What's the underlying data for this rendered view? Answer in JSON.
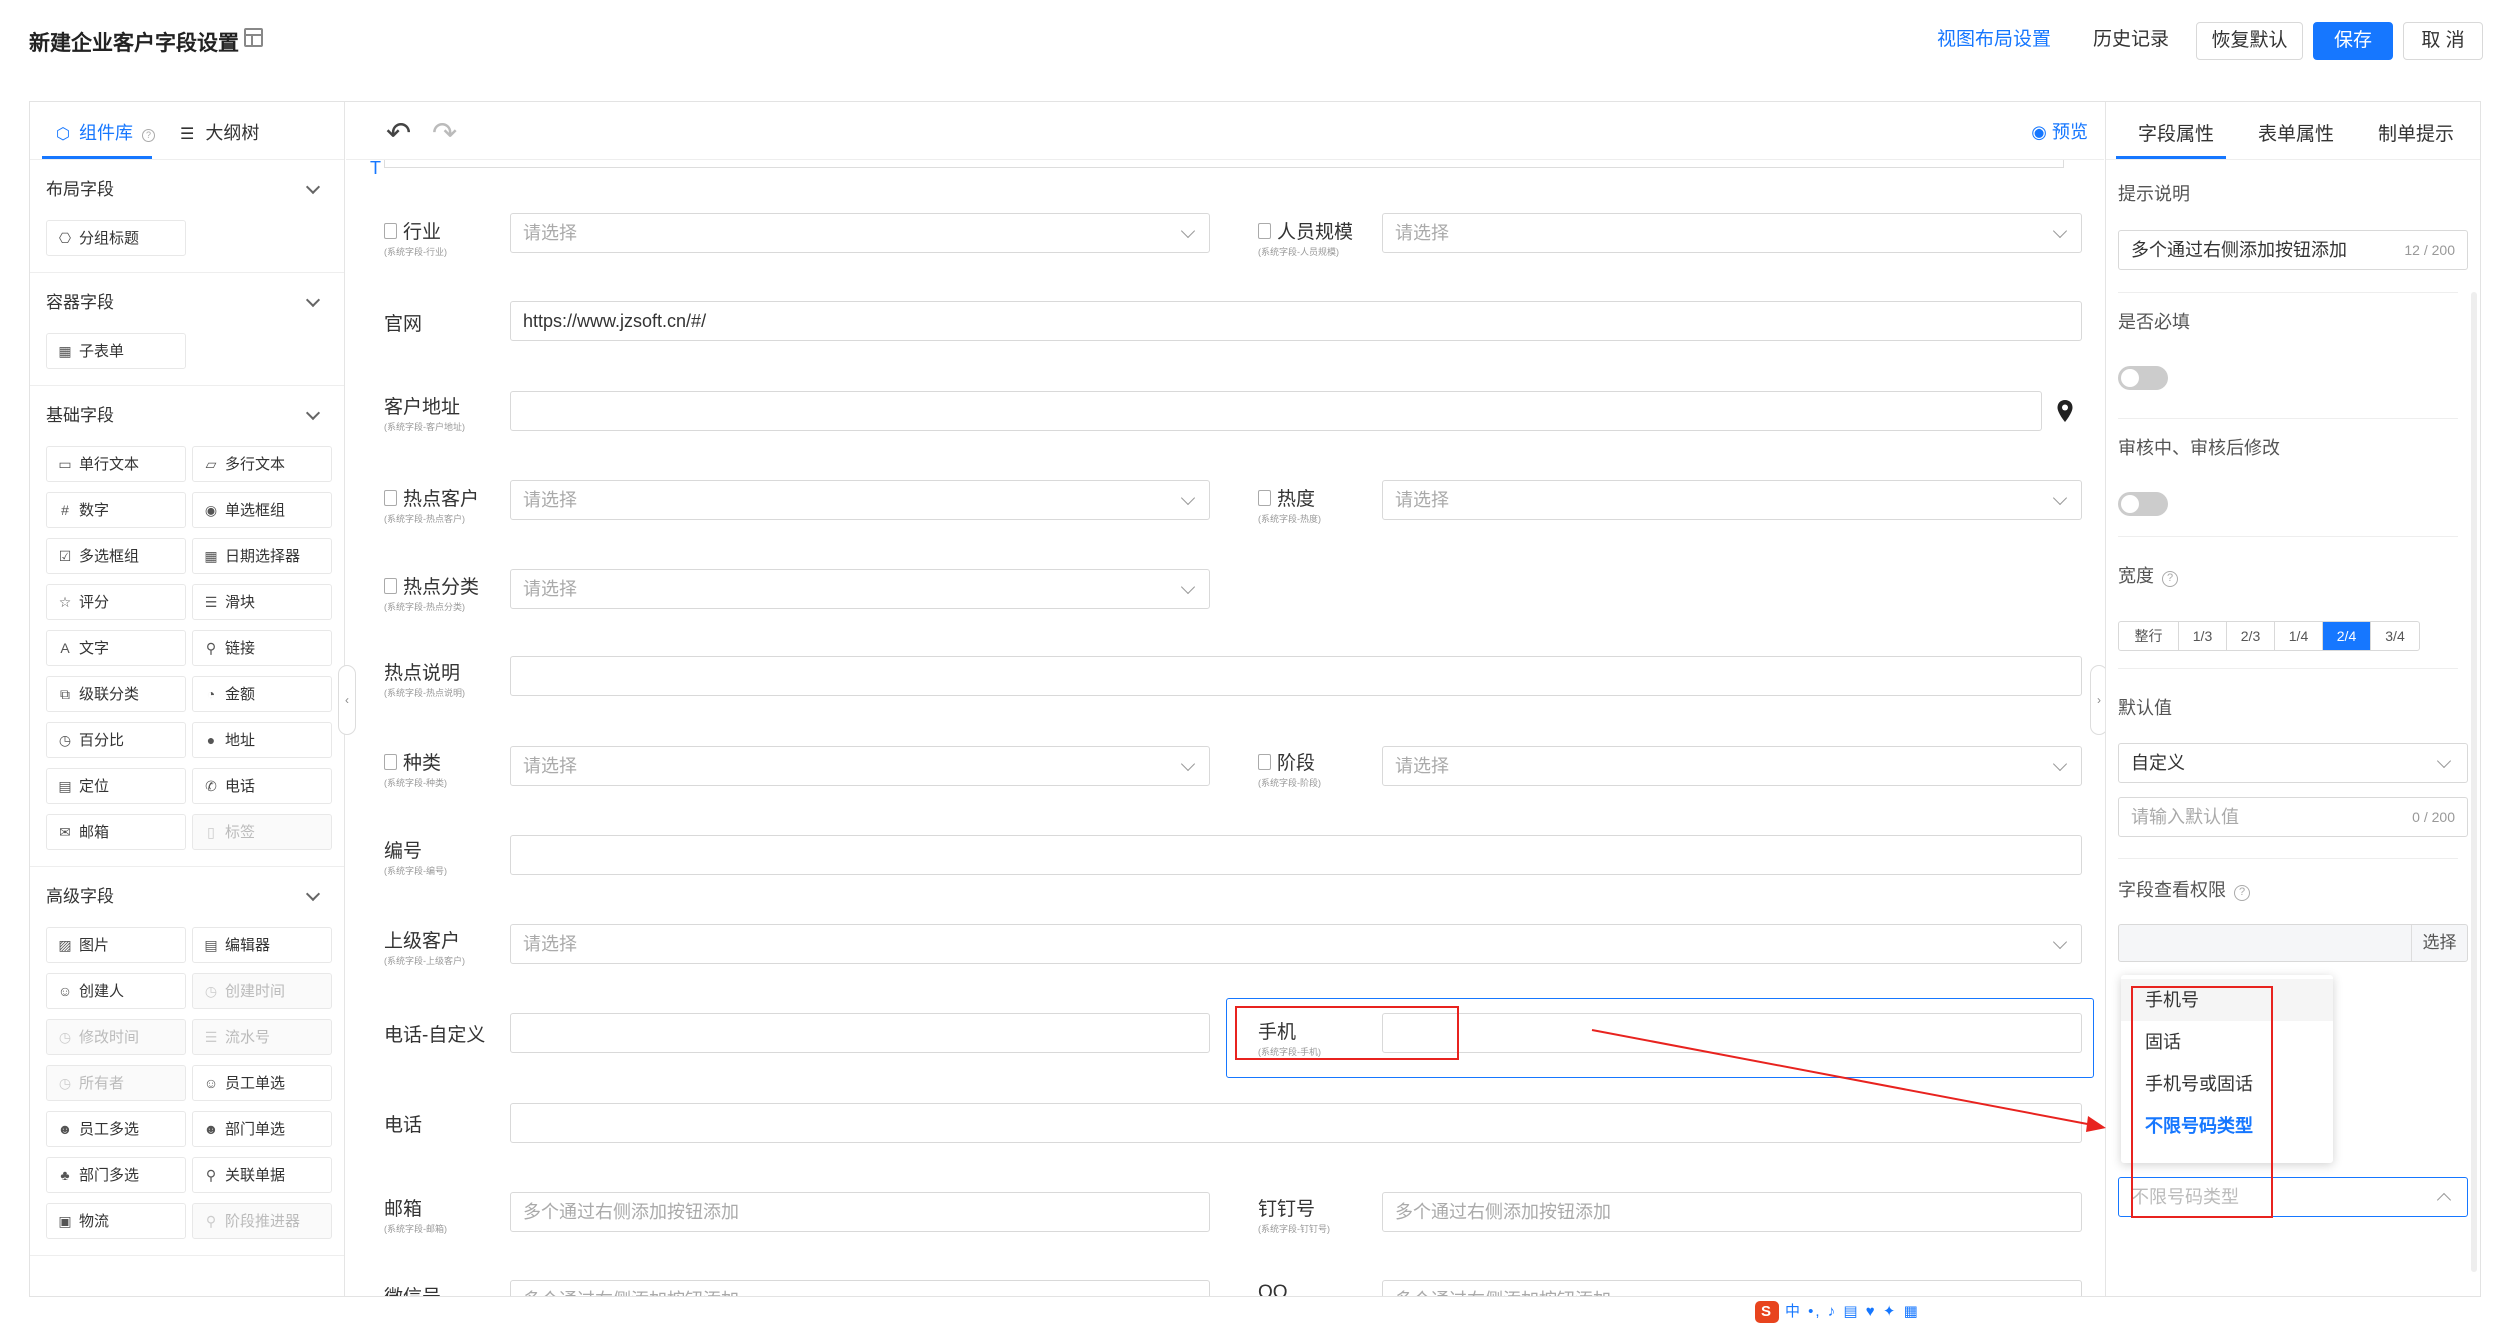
{
  "header": {
    "title": "新建企业客户字段设置",
    "layout_settings": "视图布局设置",
    "history": "历史记录",
    "restore_default": "恢复默认",
    "save": "保存",
    "cancel": "取 消"
  },
  "left_panel": {
    "tabs": [
      "组件库",
      "大纲树"
    ],
    "sections": [
      {
        "title": "布局字段",
        "items": [
          {
            "label": "分组标题",
            "icon": "group-title-icon",
            "glyph": "⎔",
            "disabled": false
          }
        ]
      },
      {
        "title": "容器字段",
        "items": [
          {
            "label": "子表单",
            "icon": "subform-icon",
            "glyph": "▦",
            "disabled": false
          }
        ]
      },
      {
        "title": "基础字段",
        "items": [
          {
            "label": "单行文本",
            "icon": "single-line-icon",
            "glyph": "▭",
            "disabled": false
          },
          {
            "label": "多行文本",
            "icon": "multi-line-icon",
            "glyph": "▱",
            "disabled": false
          },
          {
            "label": "数字",
            "icon": "number-icon",
            "glyph": "#",
            "disabled": false
          },
          {
            "label": "单选框组",
            "icon": "radio-icon",
            "glyph": "◉",
            "disabled": false
          },
          {
            "label": "多选框组",
            "icon": "checkbox-icon",
            "glyph": "☑",
            "disabled": false
          },
          {
            "label": "日期选择器",
            "icon": "date-icon",
            "glyph": "▦",
            "disabled": false
          },
          {
            "label": "评分",
            "icon": "star-icon",
            "glyph": "☆",
            "disabled": false
          },
          {
            "label": "滑块",
            "icon": "slider-icon",
            "glyph": "☰",
            "disabled": false
          },
          {
            "label": "文字",
            "icon": "text-icon",
            "glyph": "A",
            "disabled": false
          },
          {
            "label": "链接",
            "icon": "link-icon",
            "glyph": "⚲",
            "disabled": false
          },
          {
            "label": "级联分类",
            "icon": "cascade-icon",
            "glyph": "⧉",
            "disabled": false
          },
          {
            "label": "金额",
            "icon": "money-icon",
            "glyph": "◔",
            "disabled": false
          },
          {
            "label": "百分比",
            "icon": "percent-icon",
            "glyph": "◷",
            "disabled": false
          },
          {
            "label": "地址",
            "icon": "pin-icon",
            "glyph": "●",
            "disabled": false
          },
          {
            "label": "定位",
            "icon": "location-icon",
            "glyph": "▤",
            "disabled": false
          },
          {
            "label": "电话",
            "icon": "phone-icon",
            "glyph": "✆",
            "disabled": false
          },
          {
            "label": "邮箱",
            "icon": "mail-icon",
            "glyph": "✉",
            "disabled": false
          },
          {
            "label": "标签",
            "icon": "tag-icon",
            "glyph": "▯",
            "disabled": true
          }
        ]
      },
      {
        "title": "高级字段",
        "items": [
          {
            "label": "图片",
            "icon": "image-icon",
            "glyph": "▨",
            "disabled": false
          },
          {
            "label": "编辑器",
            "icon": "editor-icon",
            "glyph": "▤",
            "disabled": false
          },
          {
            "label": "创建人",
            "icon": "user-icon",
            "glyph": "☺",
            "disabled": false
          },
          {
            "label": "创建时间",
            "icon": "clock-icon",
            "glyph": "◷",
            "disabled": true
          },
          {
            "label": "修改时间",
            "icon": "clock-icon",
            "glyph": "◷",
            "disabled": true
          },
          {
            "label": "流水号",
            "icon": "serial-icon",
            "glyph": "☰",
            "disabled": true
          },
          {
            "label": "所有者",
            "icon": "owner-icon",
            "glyph": "◷",
            "disabled": true
          },
          {
            "label": "员工单选",
            "icon": "user-icon",
            "glyph": "☺",
            "disabled": false
          },
          {
            "label": "员工多选",
            "icon": "users-icon",
            "glyph": "☻",
            "disabled": false
          },
          {
            "label": "部门单选",
            "icon": "dept-icon",
            "glyph": "☻",
            "disabled": false
          },
          {
            "label": "部门多选",
            "icon": "dept-icon",
            "glyph": "♣",
            "disabled": false
          },
          {
            "label": "关联单据",
            "icon": "link-icon",
            "glyph": "⚲",
            "disabled": false
          },
          {
            "label": "物流",
            "icon": "truck-icon",
            "glyph": "▣",
            "disabled": false
          },
          {
            "label": "阶段推进器",
            "icon": "stage-icon",
            "glyph": "⚲",
            "disabled": true
          }
        ]
      }
    ]
  },
  "canvas": {
    "preview": "预览",
    "undo_icon": "undo-icon",
    "redo_icon": "redo-icon",
    "fields": {
      "industry": {
        "label": "行业",
        "sub": "(系统字段-行业)",
        "placeholder": "请选择"
      },
      "staff_size": {
        "label": "人员规模",
        "sub": "(系统字段-人员规模)",
        "placeholder": "请选择"
      },
      "website": {
        "label": "官网",
        "value": "https://www.jzsoft.cn/#/"
      },
      "address": {
        "label": "客户地址",
        "sub": "(系统字段-客户地址)",
        "value": ""
      },
      "hot_customer": {
        "label": "热点客户",
        "sub": "(系统字段-热点客户)",
        "placeholder": "请选择"
      },
      "heat": {
        "label": "热度",
        "sub": "(系统字段-热度)",
        "placeholder": "请选择"
      },
      "hot_category": {
        "label": "热点分类",
        "sub": "(系统字段-热点分类)",
        "placeholder": "请选择"
      },
      "hot_desc": {
        "label": "热点说明",
        "sub": "(系统字段-热点说明)",
        "value": ""
      },
      "kind": {
        "label": "种类",
        "sub": "(系统字段-种类)",
        "placeholder": "请选择"
      },
      "stage": {
        "label": "阶段",
        "sub": "(系统字段-阶段)",
        "placeholder": "请选择"
      },
      "code": {
        "label": "编号",
        "sub": "(系统字段-编号)",
        "value": ""
      },
      "parent": {
        "label": "上级客户",
        "sub": "(系统字段-上级客户)",
        "placeholder": "请选择"
      },
      "phone_custom": {
        "label": "电话-自定义",
        "value": ""
      },
      "mobile": {
        "label": "手机",
        "sub": "(系统字段-手机)",
        "value": ""
      },
      "phone": {
        "label": "电话",
        "value": ""
      },
      "email": {
        "label": "邮箱",
        "sub": "(系统字段-邮箱)",
        "placeholder": "多个通过右侧添加按钮添加"
      },
      "dingtalk": {
        "label": "钉钉号",
        "sub": "(系统字段-钉钉号)",
        "placeholder": "多个通过右侧添加按钮添加"
      },
      "wechat": {
        "label": "微信号",
        "placeholder": "多个通过右侧添加按钮添加"
      },
      "qq": {
        "label": "QQ",
        "placeholder": "多个通过右侧添加按钮添加"
      }
    }
  },
  "right_panel": {
    "tabs": [
      "字段属性",
      "表单属性",
      "制单提示"
    ],
    "hint_label": "提示说明",
    "hint_value": "多个通过右侧添加按钮添加",
    "hint_count": "12 / 200",
    "required_label": "是否必填",
    "required_on": false,
    "review_label": "审核中、审核后修改",
    "review_on": false,
    "width_label": "宽度",
    "width_options": [
      "整行",
      "1/3",
      "2/3",
      "1/4",
      "2/4",
      "3/4"
    ],
    "width_selected": "2/4",
    "default_label": "默认值",
    "default_mode": "自定义",
    "default_placeholder": "请输入默认值",
    "default_count": "0 / 200",
    "view_perm_label": "字段查看权限",
    "select_btn": "选择",
    "number_type_placeholder": "不限号码类型",
    "dropdown_options": [
      "手机号",
      "固话",
      "手机号或固话",
      "不限号码类型"
    ],
    "dropdown_selected": "不限号码类型",
    "dropdown_hovered": "手机号"
  },
  "colors": {
    "accent": "#1677ff",
    "annotation_red": "#e8231f"
  },
  "ime_bar": {
    "text": "中 •, ♪ ▤ ♥ ✦ ▦"
  }
}
